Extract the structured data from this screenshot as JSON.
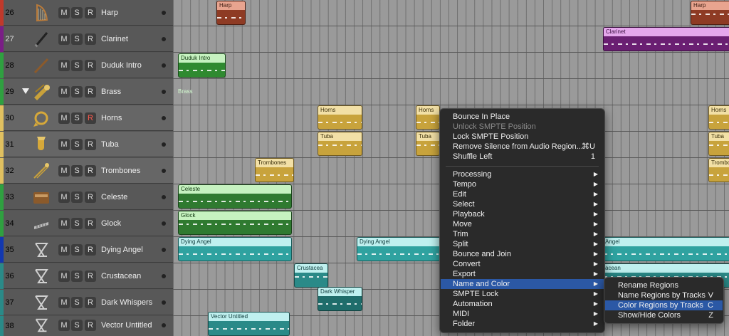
{
  "tracks": [
    {
      "num": "26",
      "name": "Harp",
      "color": "#c0392b",
      "icon": "harp-icon",
      "armed": false
    },
    {
      "num": "27",
      "name": "Clarinet",
      "color": "#7a1e86",
      "icon": "clarinet-icon",
      "armed": false
    },
    {
      "num": "28",
      "name": "Duduk Intro",
      "color": "#2fa040",
      "icon": "duduk-icon",
      "armed": false
    },
    {
      "num": "29",
      "name": "Brass",
      "color": "#2fa040",
      "icon": "brass-icon",
      "armed": false,
      "folder": true
    },
    {
      "num": "30",
      "name": "Horns",
      "color": "#e0c060",
      "icon": "horn-icon",
      "armed": true
    },
    {
      "num": "31",
      "name": "Tuba",
      "color": "#e0c060",
      "icon": "tuba-icon",
      "armed": false
    },
    {
      "num": "32",
      "name": "Trombones",
      "color": "#e0c060",
      "icon": "trombone-icon",
      "armed": false
    },
    {
      "num": "33",
      "name": "Celeste",
      "color": "#2fa040",
      "icon": "celeste-icon",
      "armed": false
    },
    {
      "num": "34",
      "name": "Glock",
      "color": "#2fa040",
      "icon": "glockenspiel-icon",
      "armed": false
    },
    {
      "num": "35",
      "name": "Dying Angel",
      "color": "#1238b0",
      "icon": "synth-icon",
      "armed": false
    },
    {
      "num": "36",
      "name": "Crustacean",
      "color": "#2a8a88",
      "icon": "synth-icon",
      "armed": false
    },
    {
      "num": "37",
      "name": "Dark Whispers",
      "color": "#2a8a88",
      "icon": "synth-icon",
      "armed": false
    },
    {
      "num": "38",
      "name": "Vector Untitled",
      "color": "#2a8a88",
      "icon": "synth-icon",
      "armed": false
    }
  ],
  "track_buttons": {
    "mute": "M",
    "solo": "S",
    "record": "R"
  },
  "regions": {
    "harp_1": "Harp",
    "harp_2": "Harp",
    "clarinet": "Clarinet",
    "duduk": "Duduk Intro",
    "brass": "Brass",
    "horns_1": "Horns",
    "horns_2": "Horns",
    "horns_3": "Horns",
    "tuba_1": "Tuba",
    "tuba_2": "Tuba",
    "tuba_3": "Tuba",
    "trombones_1": "Trombones",
    "trombones_2": "Trombones",
    "celeste": "Celeste",
    "glock": "Glock",
    "dying_1": "Dying Angel",
    "dying_2": "Dying Angel",
    "dying_3": "Angel",
    "crust_1": "Crustacea",
    "crust_2": "acean",
    "dark": "Dark Whisper",
    "vector": "Vector Untitled"
  },
  "colors": {
    "harp": "#e8a48f",
    "clarinet": "#e5a7ec",
    "duduk": "#53b34f",
    "brass_folder": "#d6ffd3",
    "brass": "#e0c264",
    "celeste": "#56a453",
    "dying": "#63c9c6",
    "menu_bg": "#2a2a2a",
    "highlight": "#2b58a5",
    "armed": "#ff5a4e"
  },
  "context_menu": {
    "top_items": [
      {
        "label": "Bounce In Place",
        "shortcut": "",
        "disabled": false
      },
      {
        "label": "Unlock SMPTE Position",
        "shortcut": "",
        "disabled": true
      },
      {
        "label": "Lock SMPTE Position",
        "shortcut": "",
        "disabled": false
      },
      {
        "label": "Remove Silence from Audio Region...",
        "shortcut": "⌘U",
        "disabled": false
      },
      {
        "label": "Shuffle Left",
        "shortcut": "1",
        "disabled": false
      }
    ],
    "submenu_items": [
      {
        "label": "Processing",
        "highlighted": false
      },
      {
        "label": "Tempo",
        "highlighted": false
      },
      {
        "label": "Edit",
        "highlighted": false
      },
      {
        "label": "Select",
        "highlighted": false
      },
      {
        "label": "Playback",
        "highlighted": false
      },
      {
        "label": "Move",
        "highlighted": false
      },
      {
        "label": "Trim",
        "highlighted": false
      },
      {
        "label": "Split",
        "highlighted": false
      },
      {
        "label": "Bounce and Join",
        "highlighted": false
      },
      {
        "label": "Convert",
        "highlighted": false
      },
      {
        "label": "Export",
        "highlighted": false
      },
      {
        "label": "Name and Color",
        "highlighted": true
      },
      {
        "label": "SMPTE Lock",
        "highlighted": false
      },
      {
        "label": "Automation",
        "highlighted": false
      },
      {
        "label": "MIDI",
        "highlighted": false
      },
      {
        "label": "Folder",
        "highlighted": false
      }
    ],
    "arrow": "▶"
  },
  "name_color_submenu": [
    {
      "label": "Rename Regions",
      "shortcut": "",
      "highlighted": false
    },
    {
      "label": "Name Regions by Tracks",
      "shortcut": "V",
      "highlighted": false
    },
    {
      "label": "Color Regions by Tracks",
      "shortcut": "C",
      "highlighted": true
    },
    {
      "label": "Show/Hide Colors",
      "shortcut": "Z",
      "highlighted": false
    }
  ]
}
